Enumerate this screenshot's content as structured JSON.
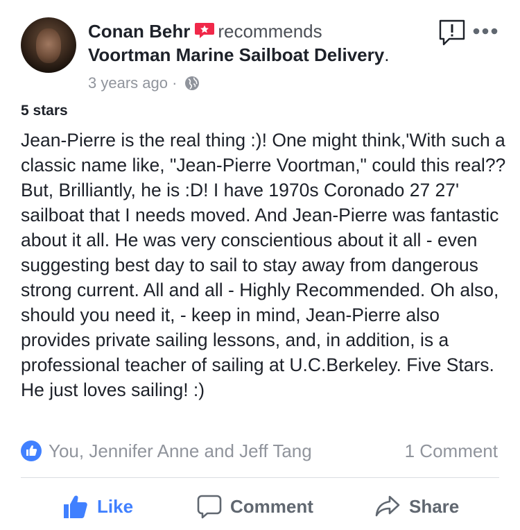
{
  "post": {
    "author": "Conan Behr",
    "verb": "recommends",
    "page_name": "Voortman Marine Sailboat Delivery",
    "page_suffix": ".",
    "time": "3 years ago",
    "separator": " · ",
    "privacy_icon": "globe-icon",
    "rating": "5 stars",
    "text": "Jean-Pierre is the real thing :)! One might think,'With such a classic name like, \"Jean-Pierre Voortman,\" could this real?? But, Brilliantly, he is :D! I have 1970s Coronado 27 27' sailboat that I needs moved. And Jean-Pierre was fantastic about it all. He was very conscientious about it all - even suggesting best day to sail to stay away from dangerous strong current. All and all - Highly Recommended. Oh also, should you need it, - keep in mind, Jean-Pierre also provides private sailing lessons, and, in addition, is a professional teacher of sailing at U.C.Berkeley. Five Stars. He just loves sailing! :)"
  },
  "reactions": {
    "names": "You, Jennifer Anne and Jeff Tang",
    "comments": "1 Comment"
  },
  "actions": {
    "like": "Like",
    "comment": "Comment",
    "share": "Share"
  },
  "colors": {
    "accent": "#4080ff",
    "recommend_badge": "#f02849",
    "text": "#1d2129",
    "muted": "#90949c"
  }
}
